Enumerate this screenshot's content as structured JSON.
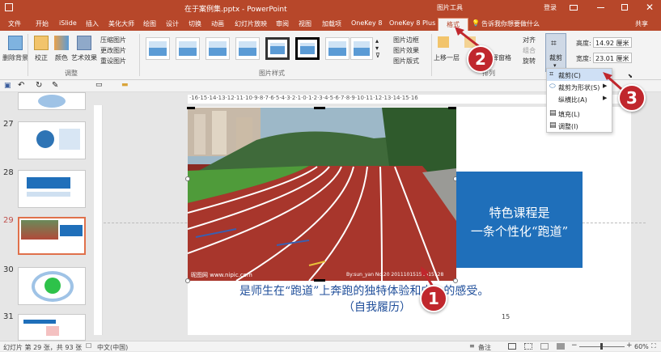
{
  "titlebar": {
    "filename": "在于案例集.pptx - PowerPoint",
    "tool_context": "图片工具",
    "login": "登录"
  },
  "tabs": [
    "文件",
    "开始",
    "iSlide",
    "插入",
    "美化大师",
    "绘图",
    "设计",
    "切换",
    "动画",
    "幻灯片放映",
    "审阅",
    "视图",
    "加载项",
    "OneKey 8",
    "OneKey 8 Plus",
    "格式"
  ],
  "tell_me": "告诉我你想要做什么",
  "share": "共享",
  "ribbon": {
    "remove_bg": "删除背景",
    "correct": "校正",
    "color": "颜色",
    "artistic": "艺术效果",
    "compress": "压缩图片",
    "change": "更改图片",
    "reset": "重设图片",
    "adjust_group": "调整",
    "styles_group": "图片样式",
    "border": "图片边框",
    "effects": "图片效果",
    "layout": "图片版式",
    "bring_forward": "上移一层",
    "selection_pane": "择窗格",
    "align": "对齐",
    "group": "组合",
    "rotate": "旋转",
    "arrange_group": "排列",
    "crop": "裁剪",
    "height_label": "高度:",
    "height_value": "14.92 厘米",
    "width_label": "宽度:",
    "width_value": "23.01 厘米"
  },
  "crop_menu": {
    "items": [
      "裁剪(C)",
      "裁剪为形状(S)",
      "纵横比(A)",
      "填充(L)",
      "调整(I)"
    ]
  },
  "slides": [
    {
      "num": "27"
    },
    {
      "num": "28"
    },
    {
      "num": "29"
    },
    {
      "num": "30"
    },
    {
      "num": "31"
    }
  ],
  "slide": {
    "ruler_text": "·16·15·14·13·12·11·10·9·8·7·6·5·4·3·2·1·0·1·2·3·4·5·6·7·8·9·10·11·12·13·14·15·16",
    "box_line1": "特色课程是",
    "box_line2": "一条个性化“跑道”",
    "caption1": "是师生在“跑道”上奔跑的独特体验和内心的感受。",
    "caption2": "（自我履历）",
    "page_num": "15",
    "watermark": "昵图网 www.nipic.com",
    "watermark_id": "By:sun_yan No.20  20111015152615128"
  },
  "callouts": [
    "1",
    "2",
    "3"
  ],
  "status": {
    "slide_info": "幻灯片 第 29 张，共 93 张",
    "language": "中文(中国)",
    "notes": "备注",
    "zoom": "60%"
  },
  "colors": {
    "accent": "#b7472a",
    "blue_box": "#1f6fba",
    "callout": "#c0272d"
  }
}
